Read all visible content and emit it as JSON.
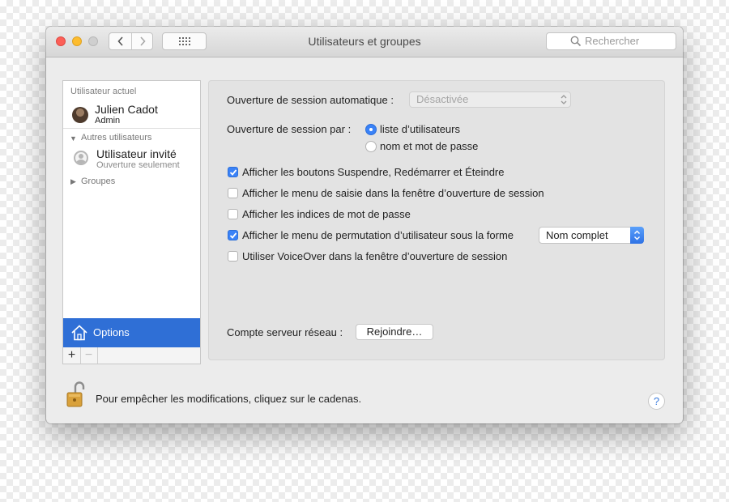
{
  "window": {
    "title": "Utilisateurs et groupes",
    "search_placeholder": "Rechercher"
  },
  "sidebar": {
    "current_header": "Utilisateur actuel",
    "current_user": {
      "name": "Julien Cadot",
      "role": "Admin"
    },
    "others_header": "Autres utilisateurs",
    "guest": {
      "name": "Utilisateur invité",
      "subtitle": "Ouverture seulement"
    },
    "groups_label": "Groupes",
    "options_label": "Options",
    "add_label": "+",
    "remove_label": "−"
  },
  "options": {
    "auto_login_label": "Ouverture de session automatique :",
    "auto_login_value": "Désactivée",
    "login_as_label": "Ouverture de session par :",
    "radios": [
      {
        "label": "liste d’utilisateurs",
        "selected": true
      },
      {
        "label": "nom et mot de passe",
        "selected": false
      }
    ],
    "checkboxes": [
      {
        "label": "Afficher les boutons Suspendre, Redémarrer et Éteindre",
        "checked": true
      },
      {
        "label": "Afficher le menu de saisie dans la fenêtre d’ouverture de session",
        "checked": false
      },
      {
        "label": "Afficher les indices de mot de passe",
        "checked": false
      },
      {
        "label": "Afficher le menu de permutation d’utilisateur sous la forme",
        "checked": true
      },
      {
        "label": "Utiliser VoiceOver dans la fenêtre d’ouverture de session",
        "checked": false
      }
    ],
    "switch_menu_value": "Nom complet",
    "network_label": "Compte serveur réseau :",
    "join_button": "Rejoindre…"
  },
  "footer": {
    "lock_text": "Pour empêcher les modifications, cliquez sur le cadenas.",
    "help_label": "?"
  },
  "colors": {
    "accent": "#3a82f7",
    "selection": "#2f6fd6",
    "window_bg": "#ececec"
  },
  "icons": [
    "search-icon",
    "back-chevron-icon",
    "forward-chevron-icon",
    "grid-icon",
    "house-icon",
    "lock-icon",
    "guest-avatar-icon",
    "checkmark-icon",
    "popup-arrows-icon"
  ]
}
